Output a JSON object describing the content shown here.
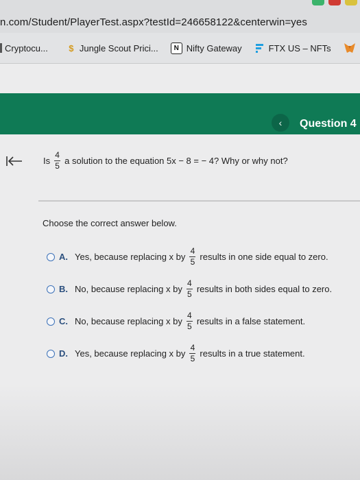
{
  "browser": {
    "url": "n.com/Student/PlayerTest.aspx?testId=246658122&centerwin=yes",
    "bookmarks": [
      {
        "label": "Cryptocu...",
        "icon": "bar-icon"
      },
      {
        "label": "Jungle Scout Prici...",
        "icon": "dollar-icon"
      },
      {
        "label": "Nifty Gateway",
        "icon": "n-logo-icon"
      },
      {
        "label": "FTX US – NFTs",
        "icon": "ftx-logo-icon"
      }
    ],
    "tab_colors": [
      "#3bb36b",
      "#d03b33",
      "#d9c23d"
    ]
  },
  "header": {
    "prev_symbol": "‹",
    "question_label": "Question 4"
  },
  "question": {
    "prefix": "Is",
    "fraction": {
      "num": "4",
      "den": "5"
    },
    "suffix": "a solution to the equation 5x − 8 = − 4? Why or why not?"
  },
  "prompt": "Choose the correct answer below.",
  "options": [
    {
      "letter": "A.",
      "pre": "Yes, because replacing x by",
      "num": "4",
      "den": "5",
      "post": "results in one side equal to zero."
    },
    {
      "letter": "B.",
      "pre": "No, because replacing x by",
      "num": "4",
      "den": "5",
      "post": "results in both sides equal to zero."
    },
    {
      "letter": "C.",
      "pre": "No, because replacing x by",
      "num": "4",
      "den": "5",
      "post": "results in a false statement."
    },
    {
      "letter": "D.",
      "pre": "Yes, because replacing x by",
      "num": "4",
      "den": "5",
      "post": "results in a true statement."
    }
  ],
  "colors": {
    "header_bar": "#0f7a55",
    "radio": "#3d72b8",
    "option_letter": "#2b4f7e"
  }
}
